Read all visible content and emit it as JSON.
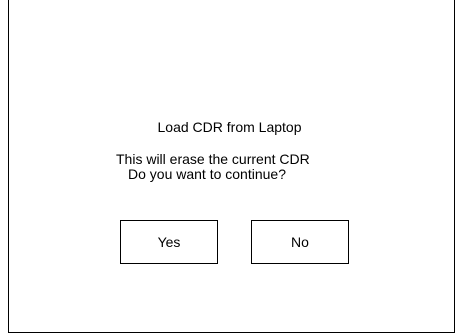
{
  "dialog": {
    "title": "Load CDR from Laptop",
    "message_line_1": "This will erase the current CDR",
    "message_line_2": "Do you want to continue?",
    "yes_label": "Yes",
    "no_label": "No"
  }
}
